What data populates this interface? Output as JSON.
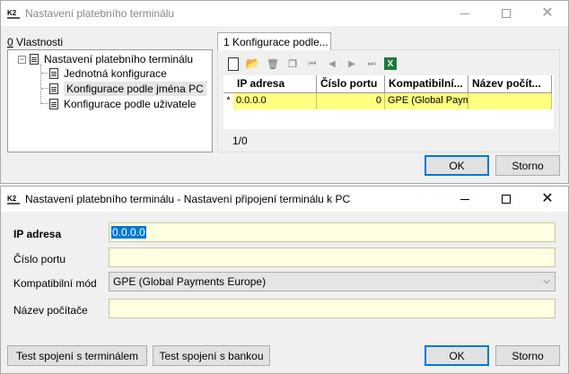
{
  "win1": {
    "title": "Nastavení platebního terminálu",
    "vlastnosti_prefix": "0",
    "vlastnosti_label": " Vlastnosti",
    "tree": {
      "root": "Nastavení platebního terminálu",
      "items": [
        "Jednotná konfigurace",
        "Konfigurace podle jména PC",
        "Konfigurace podle uživatele"
      ]
    },
    "tab_label": "1 Konfigurace podle...",
    "grid": {
      "columns": [
        "IP adresa",
        "Číslo portu",
        "Kompatibilní...",
        "Název počít..."
      ],
      "row_marker": "*",
      "row": [
        "0.0.0.0",
        "0",
        "GPE (Global Payme",
        ""
      ]
    },
    "counter": "1/0",
    "ok": "OK",
    "storno": "Storno"
  },
  "win2": {
    "title": "Nastavení platebního terminálu - Nastavení připojení terminálu k PC",
    "labels": {
      "ip": "IP adresa",
      "port": "Číslo portu",
      "mode": "Kompatibilní mód",
      "pc": "Název počítače"
    },
    "values": {
      "ip": "0.0.0.0",
      "port": "",
      "mode": "GPE (Global Payments Europe)",
      "pc": ""
    },
    "test_terminal": "Test spojení s terminálem",
    "test_bank": "Test spojení s bankou",
    "ok": "OK",
    "storno": "Storno"
  },
  "app_icon_text": "K2",
  "icons": {
    "close": "✕",
    "caret": "⌵",
    "expander": "−",
    "tb_new": "",
    "tb_open": "📂",
    "tb_delete": "🗑",
    "tb_copy": "❐",
    "tb_first": "⏮",
    "tb_prev": "◀",
    "tb_next": "▶",
    "tb_last": "⏭",
    "tb_excel": "X"
  }
}
